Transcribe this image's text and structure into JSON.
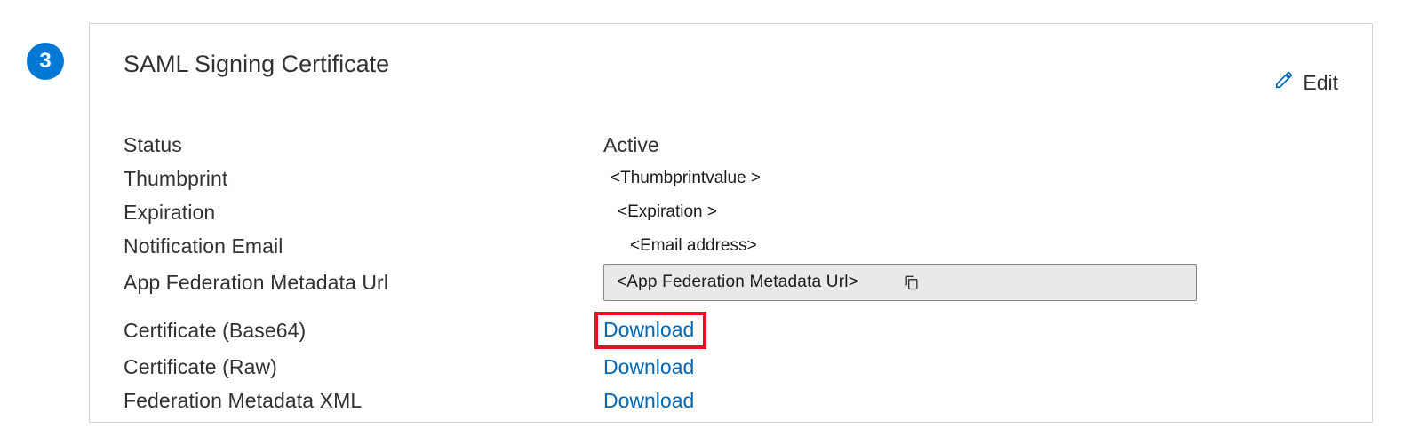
{
  "step": {
    "number": "3"
  },
  "card": {
    "title": "SAML Signing Certificate",
    "edit_label": "Edit"
  },
  "fields": {
    "status_label": "Status",
    "status_value": "Active",
    "thumbprint_label": "Thumbprint",
    "thumbprint_value": "<Thumbprintvalue >",
    "expiration_label": "Expiration",
    "expiration_value": "<Expiration >",
    "notification_label": "Notification Email",
    "notification_value": "<Email address>",
    "metadata_url_label": "App Federation Metadata Url",
    "metadata_url_value": "<App Federation  Metadata Url>",
    "cert_base64_label": "Certificate (Base64)",
    "cert_base64_link": "Download",
    "cert_raw_label": "Certificate (Raw)",
    "cert_raw_link": "Download",
    "fed_xml_label": "Federation Metadata XML",
    "fed_xml_link": "Download"
  }
}
